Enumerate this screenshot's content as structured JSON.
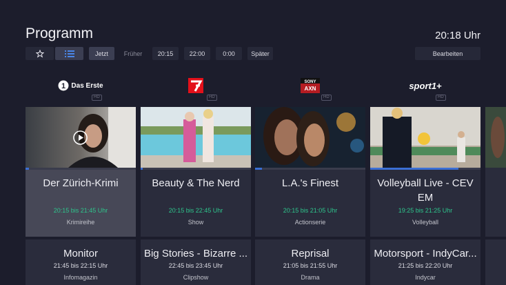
{
  "header": {
    "title": "Programm",
    "clock": "20:18 Uhr"
  },
  "toolbar": {
    "items": [
      {
        "label": ""
      },
      {
        "label": ""
      },
      {
        "label": "Jetzt"
      },
      {
        "label": "Früher"
      },
      {
        "label": "20:15"
      },
      {
        "label": "22:00"
      },
      {
        "label": "0:00"
      },
      {
        "label": "Später"
      }
    ],
    "edit_label": "Bearbeiten"
  },
  "channels": [
    {
      "name": "Das Erste",
      "hd": "HD",
      "now": {
        "title": "Der Zürich-Krimi",
        "time": "20:15 bis 21:45 Uhr",
        "genre": "Krimireihe",
        "progress": 0.03
      },
      "next": {
        "title": "Monitor",
        "time": "21:45 bis 22:15 Uhr",
        "genre": "Infomagazin"
      }
    },
    {
      "name": "ProSieben",
      "hd": "HD",
      "now": {
        "title": "Beauty & The Nerd",
        "time": "20:15 bis 22:45 Uhr",
        "genre": "Show",
        "progress": 0.02
      },
      "next": {
        "title": "Big Stories - Bizarre ...",
        "time": "22:45 bis 23:45 Uhr",
        "genre": "Clipshow"
      }
    },
    {
      "name": "SONY AXN",
      "hd": "HD",
      "now": {
        "title": "L.A.'s Finest",
        "time": "20:15 bis 21:05 Uhr",
        "genre": "Actionserie",
        "progress": 0.06
      },
      "next": {
        "title": "Reprisal",
        "time": "21:05 bis 21:55 Uhr",
        "genre": "Drama"
      }
    },
    {
      "name": "sport1+",
      "hd": "HD",
      "now": {
        "title": "Volleyball Live - CEV EM",
        "time": "19:25 bis 21:25 Uhr",
        "genre": "Volleyball",
        "progress": 0.8
      },
      "next": {
        "title": "Motorsport - IndyCar...",
        "time": "21:25 bis 22:20 Uhr",
        "genre": "Indycar"
      }
    }
  ],
  "colors": {
    "background": "#1c1d2c",
    "card": "#2a2c3c",
    "focused_card": "#474857",
    "time_green": "#2ec58c",
    "progress_blue": "#3b6fd4"
  }
}
